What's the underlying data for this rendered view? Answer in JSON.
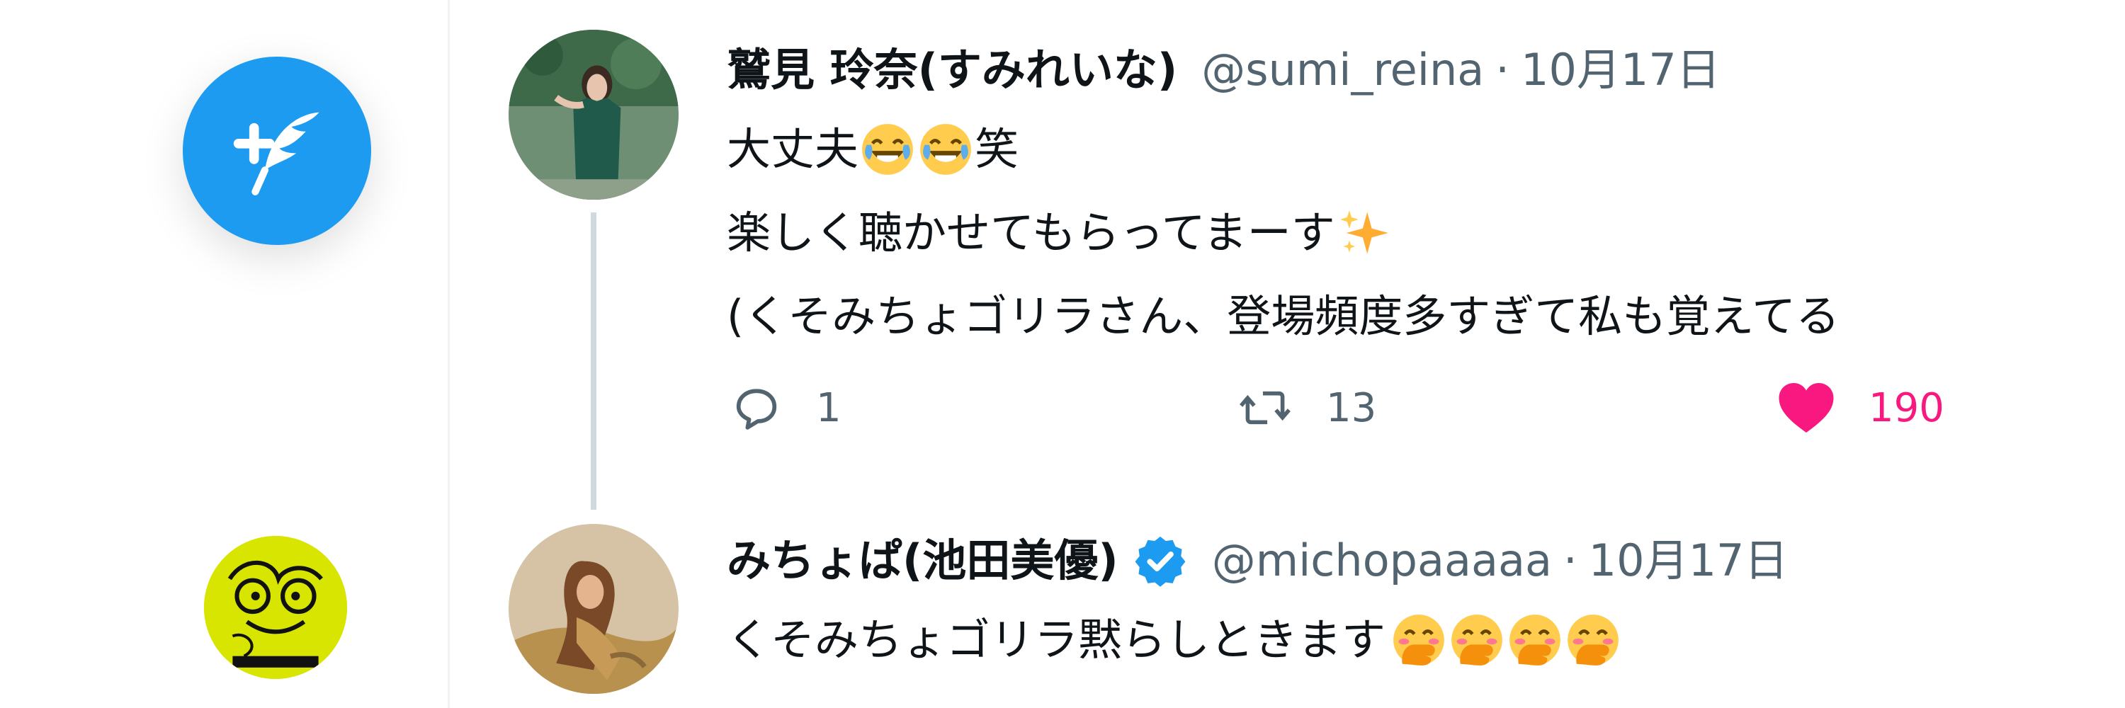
{
  "sidebar": {
    "compose_icon": "compose-tweet-feather-plus-icon",
    "account_avatar_icon": "user-avatar",
    "accent_color": "#1d9bf0"
  },
  "tweets": [
    {
      "display_name": "鷲見 玲奈(すみれいな)",
      "handle": "@sumi_reina",
      "separator": "·",
      "date": "10月17日",
      "verified": false,
      "lines": {
        "l1_a": "大丈夫",
        "l1_emoji": "face-with-tears-of-joy",
        "l1_b": "笑",
        "l2_a": "楽しく聴かせてもらってまーす",
        "l2_emoji": "sparkles",
        "l3": "(くそみちょゴリラさん、登場頻度多すぎて私も覚えてる"
      },
      "actions": {
        "reply_count": "1",
        "retweet_count": "13",
        "like_count": "190"
      }
    },
    {
      "display_name": "みちょぱ(池田美優)",
      "handle": "@michopaaaaa",
      "separator": "·",
      "date": "10月17日",
      "verified": true,
      "lines": {
        "l1_a": "くそみちょゴリラ黙らしときます",
        "l1_emoji": "face-with-hand-over-mouth"
      }
    }
  ],
  "colors": {
    "like": "#f91880",
    "muted": "#536471",
    "verified": "#1d9bf0",
    "thread_line": "#cfd9de"
  }
}
